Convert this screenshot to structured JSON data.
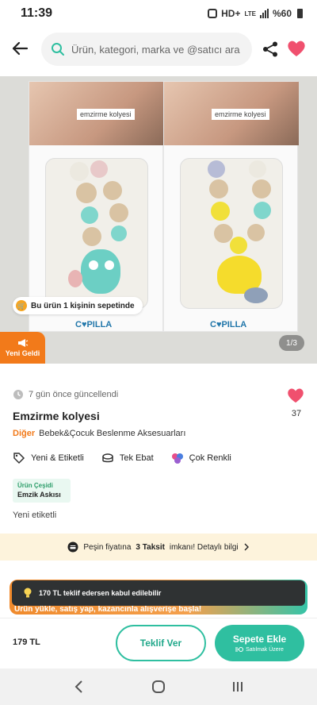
{
  "status_bar": {
    "time": "11:39",
    "network": "HD+",
    "lte": "LTE",
    "battery": "%60"
  },
  "search": {
    "placeholder": "Ürün, kategori, marka ve @satıcı ara"
  },
  "image": {
    "box_title": "emzirme kolyesi",
    "cart_badge": "Bu ürün 1 kişinin sepetinde",
    "new_tag": "Yeni Geldi",
    "page_indicator": "1/3"
  },
  "product": {
    "updated": "7 gün önce güncellendi",
    "favorite_count": "37",
    "title": "Emzirme kolyesi",
    "brand": "Diğer",
    "category": "Bebek&Çocuk Beslenme Aksesuarları",
    "features": [
      "Yeni & Etiketli",
      "Tek Ebat",
      "Çok Renkli"
    ],
    "variant_label": "Ürün Çeşidi",
    "variant_value": "Emzik Askısı",
    "condition": "Yeni etiketli"
  },
  "installment": {
    "prefix": "Peşin fiyatına",
    "bold": "3 Taksit",
    "suffix": "imkanı! Detaylı bilgi"
  },
  "promo": {
    "text": "Ürün yükle, satış yap, kazancınla alışverişe başla!"
  },
  "toast": {
    "text": "170 TL teklif edersen kabul edilebilir"
  },
  "bottom": {
    "price": "179 TL",
    "offer_label": "Teklif Ver",
    "cart_label": "Sepete Ekle",
    "cart_sub": "Satılmak Üzere"
  },
  "colors": {
    "accent": "#f27a1a",
    "green": "#2fbfa0",
    "heart": "#f0506e"
  }
}
